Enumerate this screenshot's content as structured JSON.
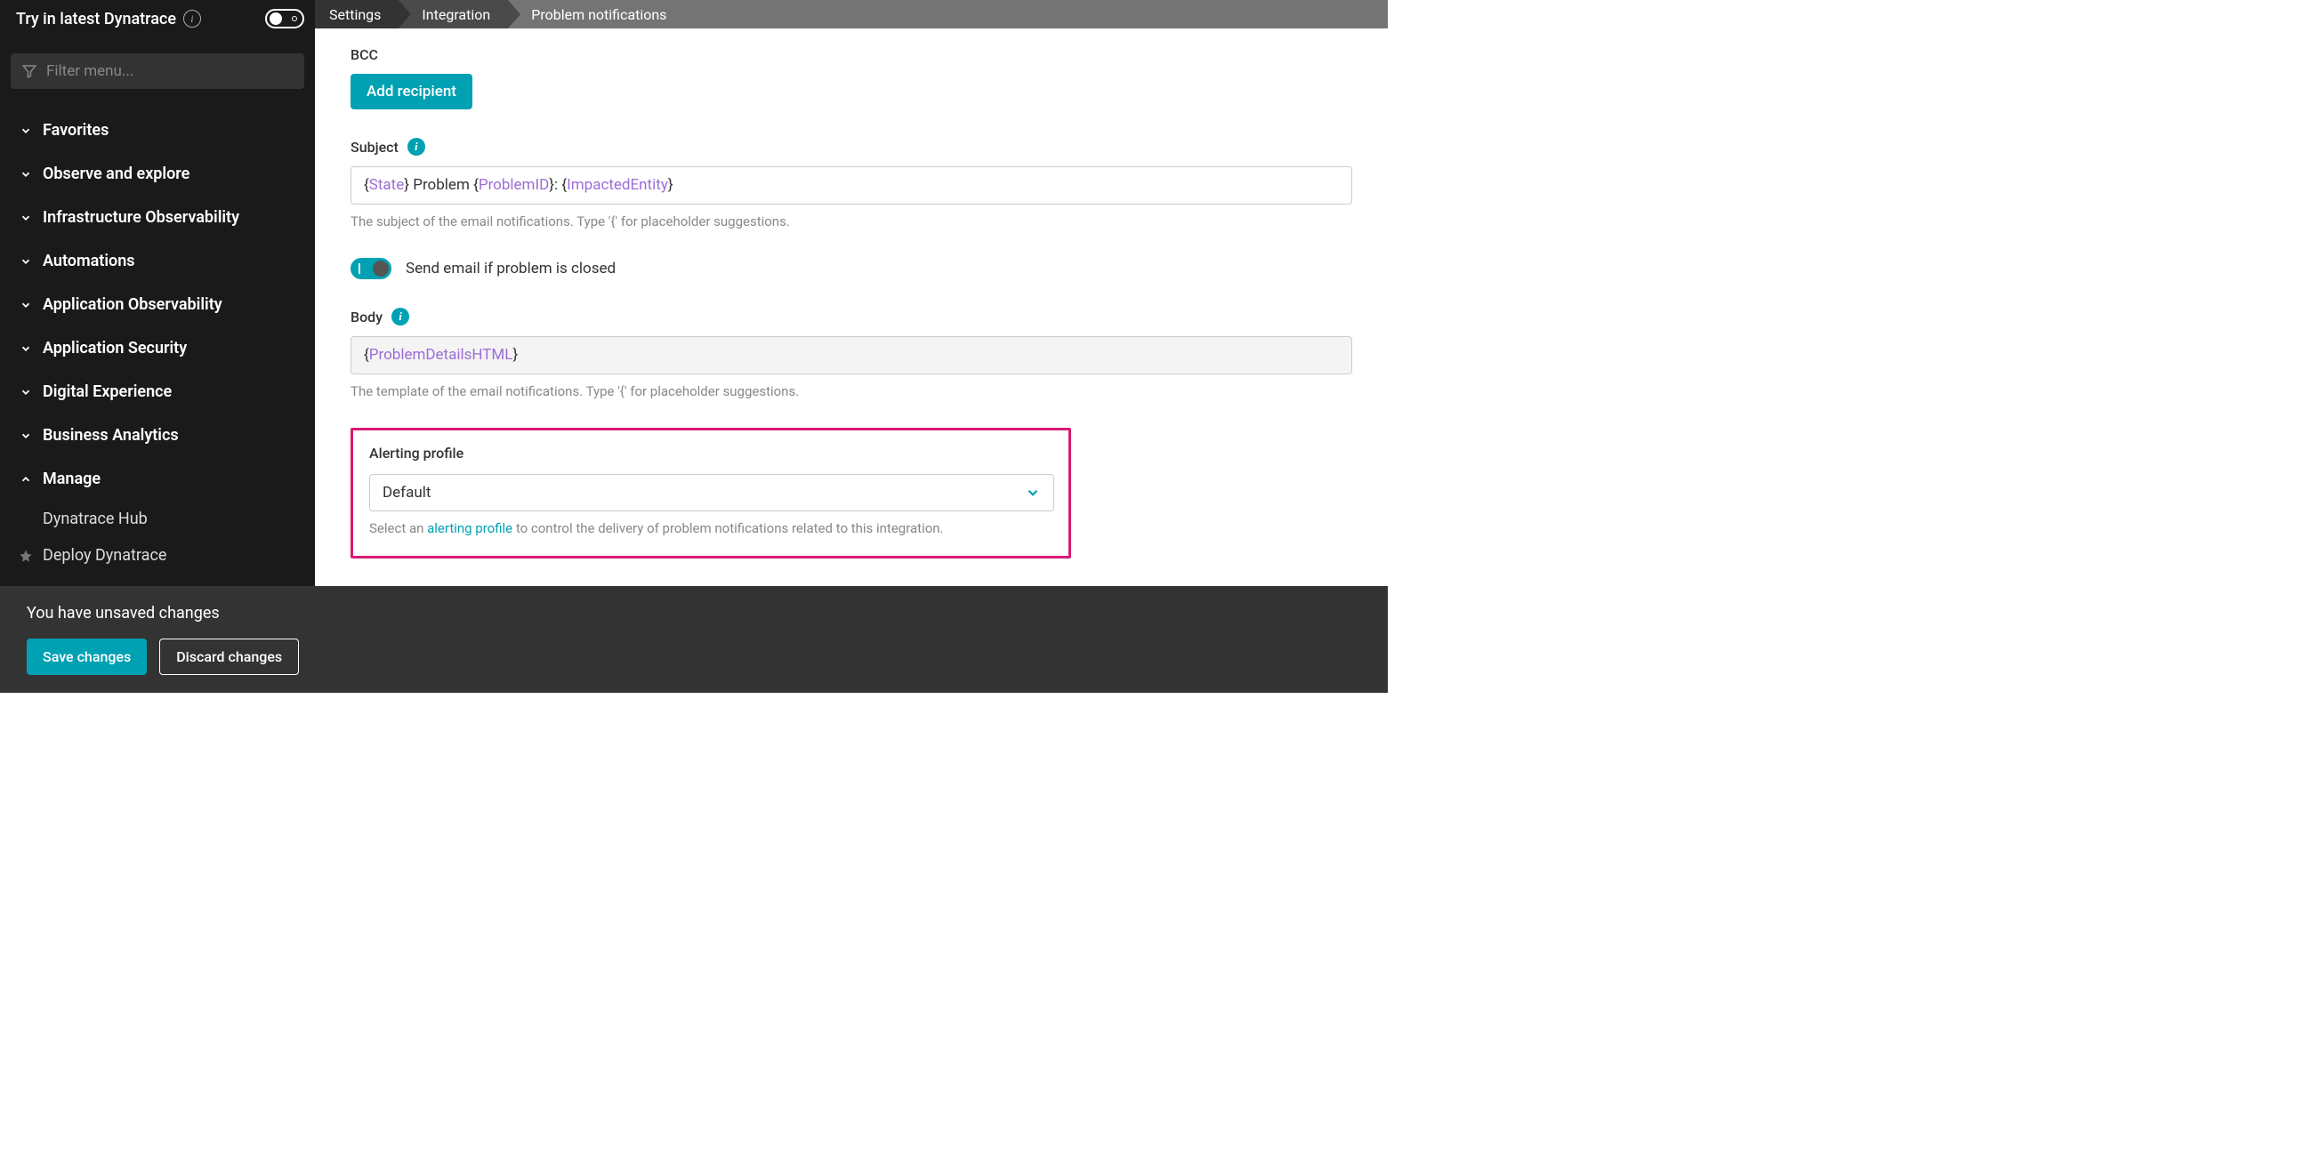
{
  "top": {
    "try_label": "Try in latest Dynatrace",
    "filter_placeholder": "Filter menu..."
  },
  "nav": {
    "items": [
      {
        "label": "Favorites",
        "expanded": false
      },
      {
        "label": "Observe and explore",
        "expanded": false
      },
      {
        "label": "Infrastructure Observability",
        "expanded": false
      },
      {
        "label": "Automations",
        "expanded": false
      },
      {
        "label": "Application Observability",
        "expanded": false
      },
      {
        "label": "Application Security",
        "expanded": false
      },
      {
        "label": "Digital Experience",
        "expanded": false
      },
      {
        "label": "Business Analytics",
        "expanded": false
      },
      {
        "label": "Manage",
        "expanded": true
      }
    ],
    "sub": [
      {
        "label": "Dynatrace Hub",
        "icon": ""
      },
      {
        "label": "Deploy Dynatrace",
        "icon": "star"
      }
    ]
  },
  "breadcrumb": {
    "items": [
      "Settings",
      "Integration",
      "Problem notifications"
    ]
  },
  "form": {
    "bcc_label": "BCC",
    "add_recipient": "Add recipient",
    "subject_label": "Subject",
    "subject_tokens": {
      "t1": "State",
      "p1": " Problem ",
      "t2": "ProblemID",
      "p2": ": ",
      "t3": "ImpactedEntity"
    },
    "subject_help": "The subject of the email notifications. Type '{' for placeholder suggestions.",
    "send_if_closed": "Send email if problem is closed",
    "body_label": "Body",
    "body_token": "ProblemDetailsHTML",
    "body_help": "The template of the email notifications. Type '{' for placeholder suggestions.",
    "alerting_label": "Alerting profile",
    "alerting_value": "Default",
    "alerting_help_pre": "Select an ",
    "alerting_help_link": "alerting profile",
    "alerting_help_post": " to control the delivery of problem notifications related to this integration."
  },
  "footer": {
    "msg": "You have unsaved changes",
    "save": "Save changes",
    "discard": "Discard changes"
  }
}
